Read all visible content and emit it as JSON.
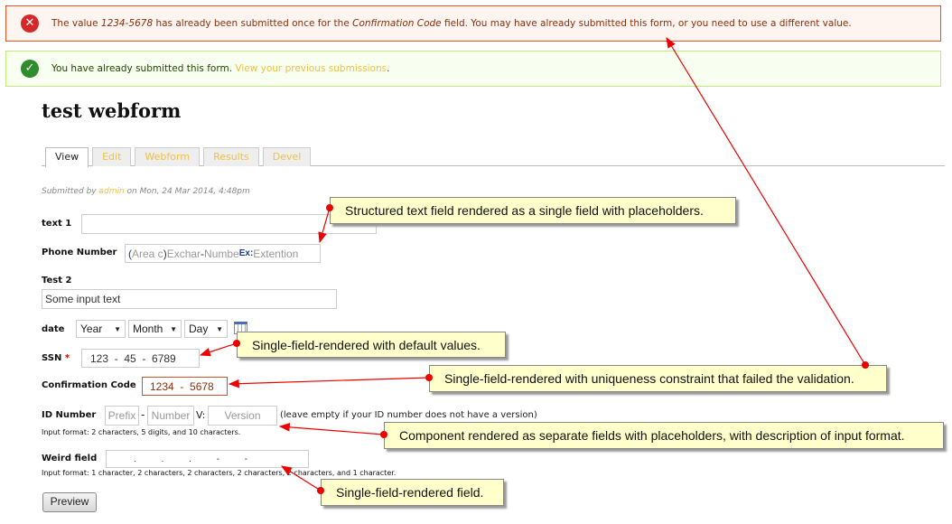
{
  "messages": {
    "error": {
      "pre": "The value ",
      "value": "1234-5678",
      "mid": " has already been submitted once for the ",
      "field": "Confirmation Code",
      "post": " field. You may have already submitted this form, or you need to use a different value."
    },
    "status": {
      "text": "You have already submitted this form. ",
      "link": "View your previous submissions",
      "end": "."
    }
  },
  "page_title": "test webform",
  "tabs": [
    "View",
    "Edit",
    "Webform",
    "Results",
    "Devel"
  ],
  "submitted": {
    "pre": "Submitted by ",
    "user": "admin",
    "post": " on Mon, 24 Mar 2014, 4:48pm"
  },
  "form": {
    "text1": {
      "label": "text 1",
      "value": ""
    },
    "phone": {
      "label": "Phone Number",
      "open": "(",
      "area": "Area c",
      "close": ")",
      "exchange": "Exchar",
      "dash": "-",
      "number": "Numbe",
      "ext_label": "Ex:",
      "ext": "Extention"
    },
    "test2": {
      "label": "Test 2",
      "value": "Some input text"
    },
    "date": {
      "label": "date",
      "year": "Year",
      "month": "Month",
      "day": "Day"
    },
    "ssn": {
      "label": "SSN",
      "required": "*",
      "value": "123  -  45  -  6789"
    },
    "confirmation": {
      "label": "Confirmation Code",
      "value": "1234  -  5678"
    },
    "id_number": {
      "label": "ID Number",
      "prefix": "Prefix",
      "dash": "-",
      "number": "Number",
      "v_label": "V:",
      "version": "Version",
      "note": "(leave empty if your ID number does not have a version)",
      "format": "Input format: 2 characters, 5 digits, and 10 characters."
    },
    "weird": {
      "label": "Weird field",
      "value": ".          .          .          -          -",
      "format": "Input format: 1 character, 2 characters, 2 characters, 2 characters, 2 characters, and 1 character."
    },
    "preview": "Preview"
  },
  "callouts": [
    "Structured text field rendered as a single field with placeholders.",
    "Single-field-rendered with default values.",
    "Single-field-rendered with uniqueness constraint that failed the validation.",
    "Component rendered as separate fields with placeholders, with description of input format.",
    "Single-field-rendered field."
  ],
  "colors": {
    "error_border": "#ed541d",
    "success_border": "#bbee77",
    "link": "#f0c040",
    "callout": "#ffffcc",
    "arrow": "#ff0000"
  }
}
